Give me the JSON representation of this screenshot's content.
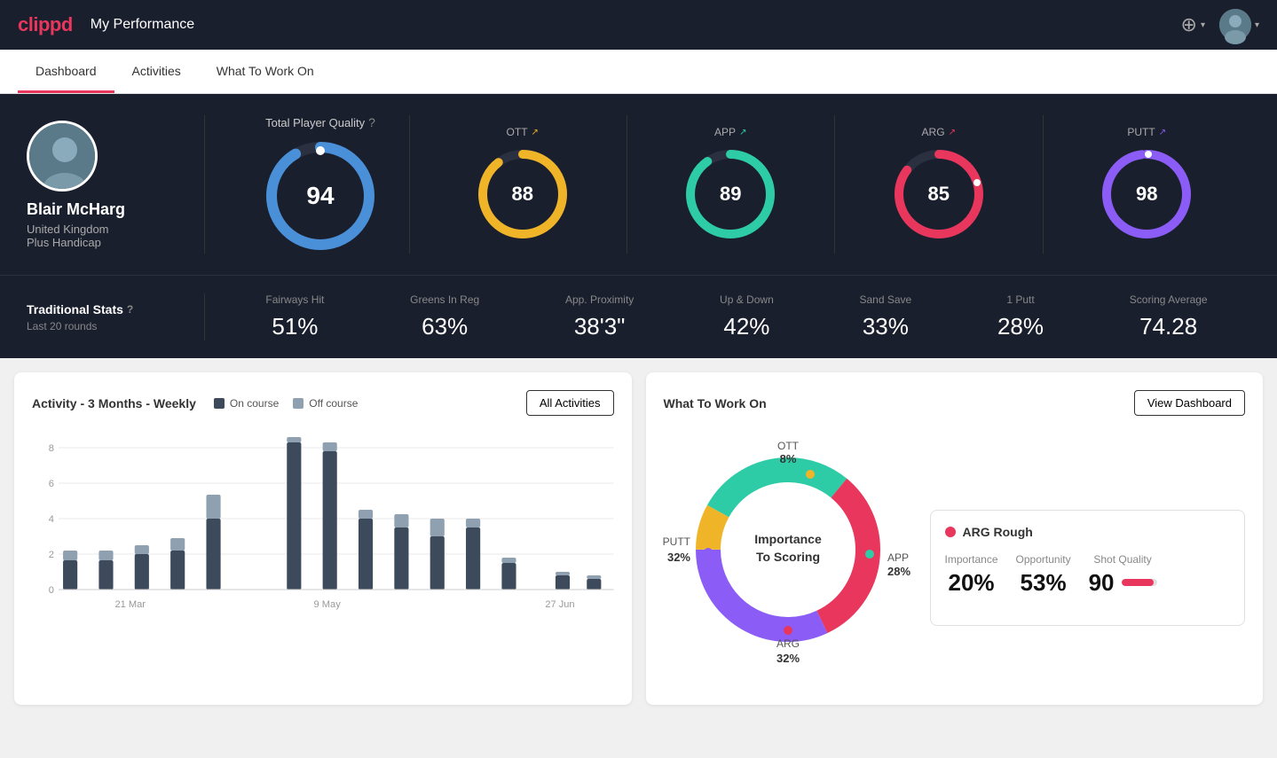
{
  "app": {
    "logo": "clippd",
    "header_title": "My Performance"
  },
  "nav": {
    "tabs": [
      {
        "id": "dashboard",
        "label": "Dashboard",
        "active": true
      },
      {
        "id": "activities",
        "label": "Activities",
        "active": false
      },
      {
        "id": "what-to-work-on",
        "label": "What To Work On",
        "active": false
      }
    ]
  },
  "player": {
    "name": "Blair McHarg",
    "country": "United Kingdom",
    "handicap": "Plus Handicap"
  },
  "total_quality": {
    "label": "Total Player Quality",
    "value": 94
  },
  "category_stats": [
    {
      "id": "ott",
      "label": "OTT",
      "value": 88,
      "color": "#f0b429"
    },
    {
      "id": "app",
      "label": "APP",
      "value": 89,
      "color": "#2dcca7"
    },
    {
      "id": "arg",
      "label": "ARG",
      "value": 85,
      "color": "#e8365d"
    },
    {
      "id": "putt",
      "label": "PUTT",
      "value": 98,
      "color": "#8b5cf6"
    }
  ],
  "traditional_stats": {
    "label": "Traditional Stats",
    "sublabel": "Last 20 rounds",
    "items": [
      {
        "label": "Fairways Hit",
        "value": "51%"
      },
      {
        "label": "Greens In Reg",
        "value": "63%"
      },
      {
        "label": "App. Proximity",
        "value": "38'3\""
      },
      {
        "label": "Up & Down",
        "value": "42%"
      },
      {
        "label": "Sand Save",
        "value": "33%"
      },
      {
        "label": "1 Putt",
        "value": "28%"
      },
      {
        "label": "Scoring Average",
        "value": "74.28"
      }
    ]
  },
  "activity_chart": {
    "title": "Activity - 3 Months - Weekly",
    "legend_on": "On course",
    "legend_off": "Off course",
    "btn_label": "All Activities",
    "x_labels": [
      "21 Mar",
      "9 May",
      "27 Jun"
    ],
    "y_labels": [
      "0",
      "2",
      "4",
      "6",
      "8"
    ],
    "bars": [
      {
        "on": 1.5,
        "off": 0.5
      },
      {
        "on": 1.5,
        "off": 0.5
      },
      {
        "on": 2.0,
        "off": 0.5
      },
      {
        "on": 2.2,
        "off": 0.8
      },
      {
        "on": 4.0,
        "off": 1.5
      },
      {
        "on": 8.5,
        "off": 0.3
      },
      {
        "on": 8.0,
        "off": 0.5
      },
      {
        "on": 4.0,
        "off": 0.5
      },
      {
        "on": 3.5,
        "off": 0.8
      },
      {
        "on": 3.0,
        "off": 1.0
      },
      {
        "on": 3.5,
        "off": 0.5
      },
      {
        "on": 1.5,
        "off": 0.3
      },
      {
        "on": 0.0,
        "off": 0.0
      },
      {
        "on": 0.8,
        "off": 0.2
      },
      {
        "on": 0.6,
        "off": 0.2
      }
    ],
    "max_val": 9
  },
  "work_on": {
    "title": "What To Work On",
    "btn_label": "View Dashboard",
    "donut": {
      "center_text1": "Importance",
      "center_text2": "To Scoring",
      "segments": [
        {
          "label": "OTT",
          "value": 8,
          "color": "#f0b429",
          "pct": "8%"
        },
        {
          "label": "APP",
          "value": 28,
          "color": "#2dcca7",
          "pct": "28%"
        },
        {
          "label": "ARG",
          "value": 32,
          "color": "#e8365d",
          "pct": "32%"
        },
        {
          "label": "PUTT",
          "value": 32,
          "color": "#8b5cf6",
          "pct": "32%"
        }
      ]
    },
    "panel": {
      "title": "ARG Rough",
      "dot_color": "#e8365d",
      "metrics": [
        {
          "label": "Importance",
          "value": "20%",
          "bar_fill": 20
        },
        {
          "label": "Opportunity",
          "value": "53%",
          "bar_fill": 53
        },
        {
          "label": "Shot Quality",
          "value": "90",
          "bar_fill": 90
        }
      ]
    }
  }
}
